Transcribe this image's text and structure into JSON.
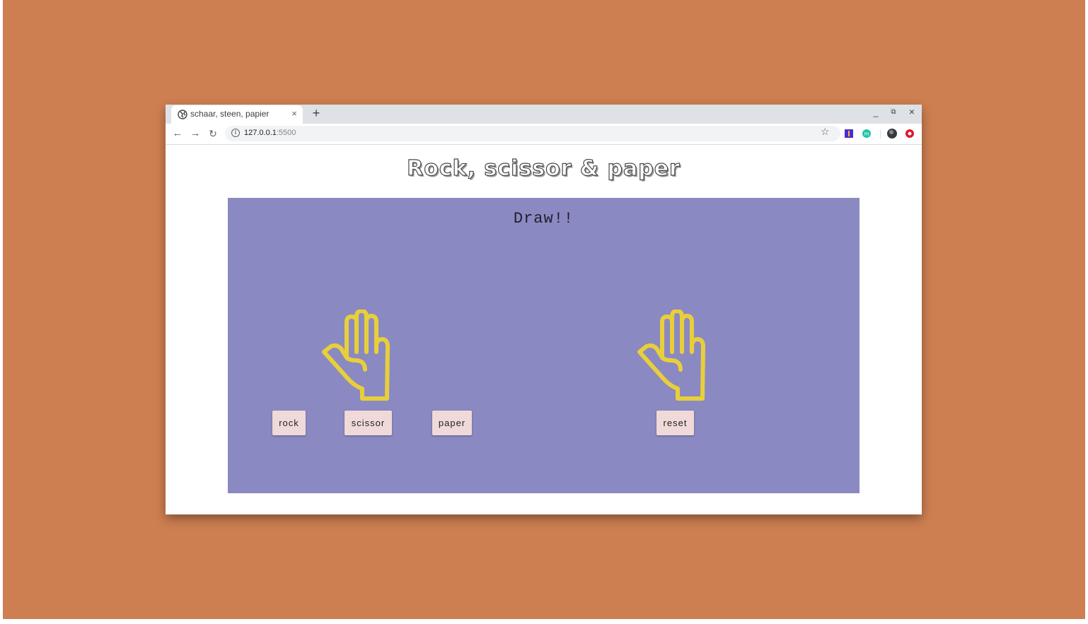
{
  "browser": {
    "tab_title": "schaar, steen, papier",
    "tab_close": "×",
    "new_tab": "+",
    "url_host": "127.0.0.1",
    "url_port": ":5500",
    "window_controls": {
      "minimize": "_",
      "restore": "⧉",
      "close": "×"
    }
  },
  "page": {
    "title": "Rock, scissor & paper",
    "result": "Draw!!",
    "player_hand_icon": "paper-hand-icon",
    "computer_hand_icon": "paper-hand-icon",
    "hand_color": "#e8cf3a",
    "buttons": {
      "rock": "rock",
      "scissor": "scissor",
      "paper": "paper",
      "reset": "reset"
    }
  },
  "colors": {
    "backdrop": "#cd7f51",
    "game_box": "#8b89c1",
    "button_bg": "#f0d9d9"
  }
}
